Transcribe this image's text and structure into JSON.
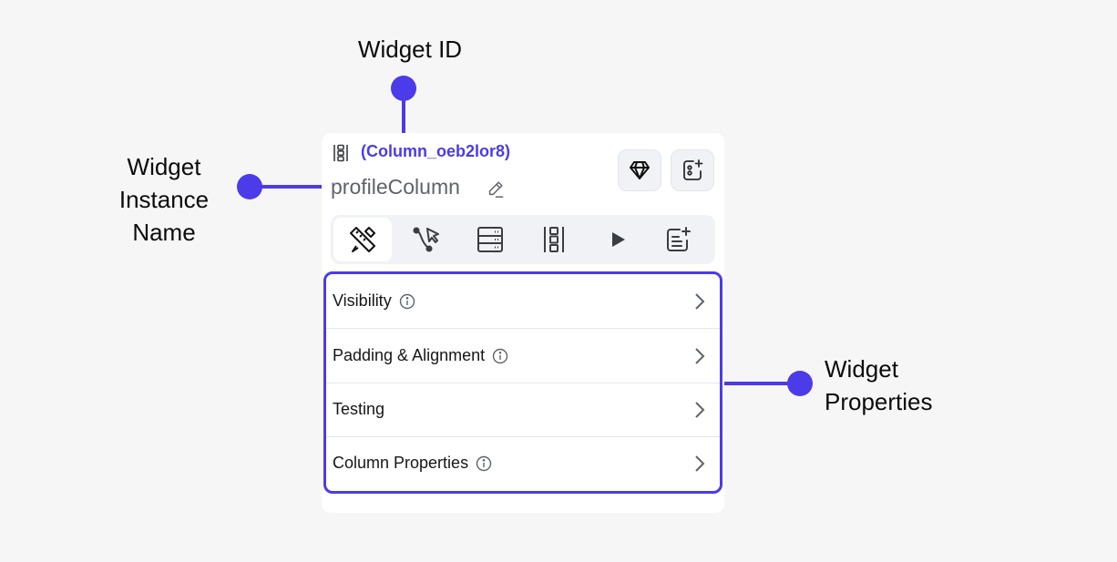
{
  "annotations": {
    "widget_id": "Widget ID",
    "instance_name": [
      "Widget",
      "Instance",
      "Name"
    ],
    "properties": [
      "Widget",
      "Properties"
    ]
  },
  "panel": {
    "widget_type_icon": "column-icon",
    "widget_id": "(Column_oeb2lor8)",
    "instance_name": "profileColumn",
    "edit_icon": "pencil-icon",
    "action_buttons": [
      {
        "name": "diamond-icon"
      },
      {
        "name": "add-widget-icon"
      }
    ],
    "tabs": [
      {
        "name": "properties-tab",
        "icon": "ruler-pencil-icon",
        "active": true
      },
      {
        "name": "actions-tab",
        "icon": "flow-cursor-icon",
        "active": false
      },
      {
        "name": "backend-query-tab",
        "icon": "server-icon",
        "active": false
      },
      {
        "name": "widget-tree-tab",
        "icon": "column-icon",
        "active": false
      },
      {
        "name": "animations-tab",
        "icon": "play-icon",
        "active": false
      },
      {
        "name": "notes-tab",
        "icon": "note-add-icon",
        "active": false
      }
    ],
    "sections": [
      {
        "label": "Visibility",
        "info": true
      },
      {
        "label": "Padding & Alignment",
        "info": true
      },
      {
        "label": "Testing",
        "info": false
      },
      {
        "label": "Column Properties",
        "info": true
      }
    ]
  },
  "colors": {
    "accent": "#4b3be8",
    "background": "#f6f6f7"
  }
}
